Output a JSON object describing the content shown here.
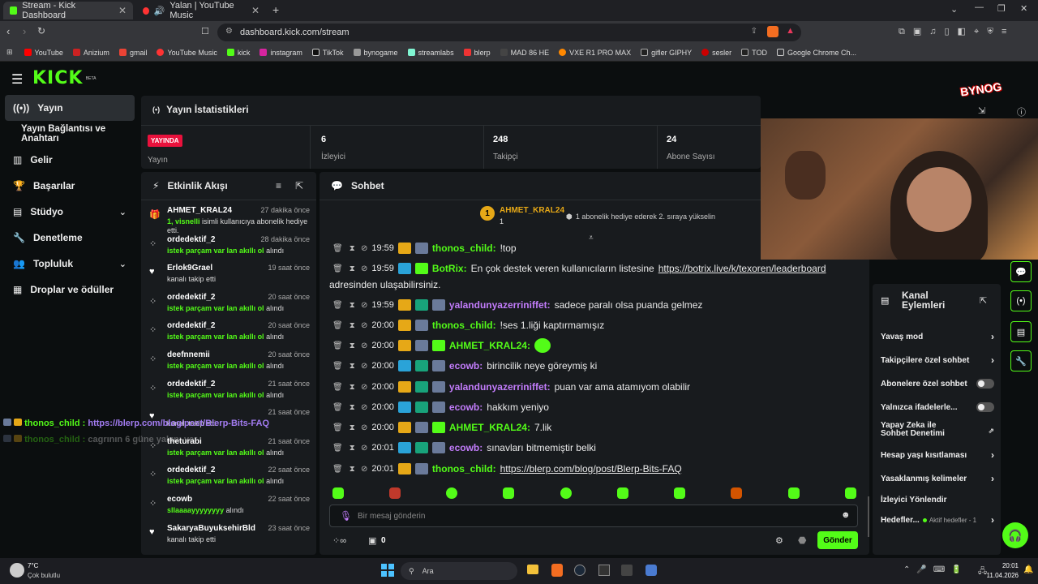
{
  "browser": {
    "tabs": [
      {
        "title": "Stream - Kick Dashboard"
      },
      {
        "title": "Yalan | YouTube Music"
      }
    ],
    "url": "dashboard.kick.com/stream",
    "bookmarks": [
      "YouTube",
      "Anizium",
      "gmail",
      "YouTube Music",
      "kick",
      "instagram",
      "TikTok",
      "bynogame",
      "streamlabs",
      "blerp",
      "MAD 86 HE",
      "VXE R1 PRO MAX",
      "gifler GIPHY",
      "sesler",
      "TOD",
      "Google Chrome Ch..."
    ]
  },
  "app": {
    "logo": "KICK",
    "logo_sup": "BETA"
  },
  "sidebar": {
    "items": [
      {
        "label": "Yayın"
      },
      {
        "label": "Yayın Bağlantısı ve Anahtarı"
      },
      {
        "label": "Gelir"
      },
      {
        "label": "Başarılar"
      },
      {
        "label": "Stüdyo"
      },
      {
        "label": "Denetleme"
      },
      {
        "label": "Topluluk"
      },
      {
        "label": "Droplar ve ödüller"
      }
    ]
  },
  "stats": {
    "title": "Yayın İstatistikleri",
    "live_badge": "YAYINDA",
    "live_label": "Yayın",
    "viewers_value": "6",
    "viewers_label": "İzleyici",
    "followers_value": "248",
    "followers_label": "Takipçi",
    "subs_value": "24",
    "subs_label": "Abone Sayısı"
  },
  "activity": {
    "title": "Etkinlik Akışı",
    "events": [
      {
        "user": "AHMET_KRAL24",
        "time": "27 dakika önce",
        "desc_bold": "1, visnelli",
        "desc": " isimli kullanıcıya abonelik hediye etti."
      },
      {
        "user": "ordedektif_2",
        "time": "28 dakika önce",
        "desc_bold": "istek parçam var lan akıllı ol",
        "desc": " alındı"
      },
      {
        "user": "Erlok9Grael",
        "time": "19 saat önce",
        "desc_bold": "",
        "desc": "kanalı takip etti"
      },
      {
        "user": "ordedektif_2",
        "time": "20 saat önce",
        "desc_bold": "istek parçam var lan akıllı ol",
        "desc": " alındı"
      },
      {
        "user": "ordedektif_2",
        "time": "20 saat önce",
        "desc_bold": "istek parçam var lan akıllı ol",
        "desc": " alındı"
      },
      {
        "user": "deefnnemii",
        "time": "20 saat önce",
        "desc_bold": "istek parçam var lan akıllı ol",
        "desc": " alındı"
      },
      {
        "user": "ordedektif_2",
        "time": "21 saat önce",
        "desc_bold": "istek parçam var lan akıllı ol",
        "desc": " alındı"
      },
      {
        "user": "",
        "time": "21 saat önce",
        "desc_bold": "",
        "desc": "kanalı takip etti"
      },
      {
        "user": "theturabi",
        "time": "21 saat önce",
        "desc_bold": "istek parçam var lan akıllı ol",
        "desc": " alındı"
      },
      {
        "user": "ordedektif_2",
        "time": "22 saat önce",
        "desc_bold": "istek parçam var lan akıllı ol",
        "desc": " alındı"
      },
      {
        "user": "ecowb",
        "time": "22 saat önce",
        "desc_bold": "sllaaaayyyyyyyy",
        "desc": " alındı"
      },
      {
        "user": "SakaryaBuyuksehirBld",
        "time": "23 saat önce",
        "desc_bold": "",
        "desc": "kanalı takip etti"
      }
    ]
  },
  "chat": {
    "title": "Sohbet",
    "pinned_user": "AHMET_KRAL24",
    "pinned_count": "1",
    "pinned_text": "1 abonelik hediye ederek 2. sıraya yükselin",
    "messages": [
      {
        "time": "19:59",
        "user": "thonos_child",
        "color": "green",
        "text": "!top"
      },
      {
        "time": "19:59",
        "user": "BotRix",
        "color": "green",
        "text": "En çok destek veren kullanıcıların listesine ",
        "link": "https://botrix.live/k/texoren/leaderboard",
        "cont": "adresinden ulaşabilirsiniz."
      },
      {
        "time": "19:59",
        "user": "yalandunyazerriniffet",
        "color": "purple",
        "text": "sadece paralı olsa puanda gelmez"
      },
      {
        "time": "20:00",
        "user": "thonos_child",
        "color": "green",
        "text": "!ses 1.liği kaptırmamışız"
      },
      {
        "time": "20:00",
        "user": "AHMET_KRAL24",
        "color": "green",
        "text": ""
      },
      {
        "time": "20:00",
        "user": "ecowb",
        "color": "purple",
        "text": "birincilik neye göreymiş ki"
      },
      {
        "time": "20:00",
        "user": "yalandunyazerriniffet",
        "color": "purple",
        "text": "puan var ama atamıyom olabilir"
      },
      {
        "time": "20:00",
        "user": "ecowb",
        "color": "purple",
        "text": "hakkım yeniyo"
      },
      {
        "time": "20:00",
        "user": "AHMET_KRAL24",
        "color": "green",
        "text": "7.lik"
      },
      {
        "time": "20:01",
        "user": "ecowb",
        "color": "purple",
        "text": "sınavları bitmemiştir belki"
      },
      {
        "time": "20:01",
        "user": "thonos_child",
        "color": "green",
        "text": "",
        "link": "https://blerp.com/blog/post/Blerp-Bits-FAQ"
      }
    ],
    "input_placeholder": "Bir mesaj gönderin",
    "points": "0",
    "send_label": "Gönder"
  },
  "overlay": {
    "line1_user": "thonos_child :",
    "line1_text": "https://blerp.com/blog/post/Blerp-Bits-FAQ",
    "line2_user": "thonos_child :",
    "line2_text": "cagrının 6 güne yakını var"
  },
  "webcam": {
    "logo": "BYNOG"
  },
  "channel_actions": {
    "title_line1": "Kanal",
    "title_line2": "Eylemleri",
    "items": [
      {
        "label": "Yavaş mod"
      },
      {
        "label": "Takipçilere özel sohbet"
      },
      {
        "label": "Abonelere özel sohbet"
      },
      {
        "label": "Yalnızca ifadelerle..."
      },
      {
        "label": "Yapay Zeka ile Sohbet Denetimi"
      },
      {
        "label": "Hesap yaşı kısıtlaması"
      },
      {
        "label": "Yasaklanmış kelimeler"
      },
      {
        "label": "İzleyici Yönlendir"
      },
      {
        "label": "Hedefler..."
      }
    ],
    "goals_sub": "Aktif hedefler - 1"
  },
  "taskbar": {
    "weather_temp": "7°C",
    "weather_desc": "Çok bulutlu",
    "search": "Ara",
    "time": "20:01",
    "date": "11.04.2026"
  }
}
